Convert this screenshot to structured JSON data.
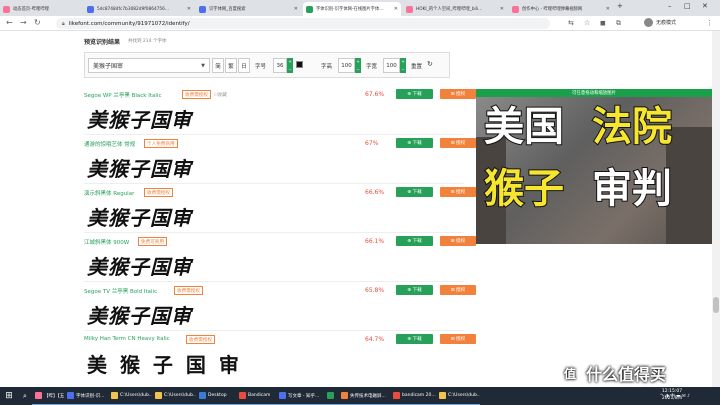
{
  "browser": {
    "tabs": [
      {
        "label": "动态首页-哔哩哔哩",
        "color": "#fb7299"
      },
      {
        "label": "5dc87484fc7b3082d9f0864756...",
        "color": "#4e6ef2"
      },
      {
        "label": "识字体网_百度搜索",
        "color": "#4e6ef2"
      },
      {
        "label": "字体识别-识字体网-在线图片字体...",
        "color": "#27a15a"
      },
      {
        "label": "HOKI_的个人空间_哔哩哔哩_bili...",
        "color": "#fb7299"
      },
      {
        "label": "创作中心 - 哔哩哔哩弹幕视频网",
        "color": "#fb7299"
      }
    ],
    "new_tab": "+",
    "minimize": "–",
    "maximize": "□",
    "close": "✕",
    "url": "likefont.com/community/91971072/identify/",
    "profile": "无痕模式"
  },
  "page": {
    "result_title": "预览识别结果",
    "result_count": "共找到 214 个字体",
    "controls": {
      "text_value": "美猴子国审",
      "simplified": "简",
      "traditional": "繁",
      "sun": "日",
      "size_label": "字号",
      "size_value": "36",
      "height_label": "字高",
      "height_value": "100",
      "width_label": "字宽",
      "width_value": "100",
      "reset": "重置"
    },
    "rows": [
      {
        "name": "Segoe WP 兰亭黑 Black Italic",
        "tag": "收费需授权",
        "fav": "☆收藏",
        "pct": "67.6%",
        "download": "下载",
        "authorize": "授权",
        "preview": "美猴子国审"
      },
      {
        "name": "通游的惊哦艺体 常规",
        "tag": "个人免费商用",
        "fav": "",
        "pct": "67%",
        "download": "下载",
        "authorize": "授权",
        "preview": "美猴子国审"
      },
      {
        "name": "演示斜黑体 Regular",
        "tag": "收费需授权",
        "fav": "",
        "pct": "66.6%",
        "download": "下载",
        "authorize": "授权",
        "preview": "美猴子国审"
      },
      {
        "name": "江城斜黑体 900W",
        "tag": "免费可商用",
        "fav": "",
        "pct": "66.1%",
        "download": "下载",
        "authorize": "授权",
        "preview": "美猴子国审"
      },
      {
        "name": "Segoe TV 兰亭黑 Bold Italic",
        "tag": "收费需授权",
        "fav": "",
        "pct": "65.8%",
        "download": "下载",
        "authorize": "授权",
        "preview": "美猴子国审"
      },
      {
        "name": "Milky Han Term CN Heavy Italic",
        "tag": "收费需授权",
        "fav": "",
        "pct": "64.7%",
        "download": "下载",
        "authorize": "授权",
        "preview": "美 猴 子 国 审"
      }
    ],
    "float_player": {
      "hint": "可任意拖动和缩放图片",
      "line1_white": "美国",
      "line1_yellow": "法院",
      "line2_yellow": "猴子",
      "line2_white": "审判"
    }
  },
  "taskbar": {
    "start": "⊞",
    "search": "⌕",
    "items": [
      {
        "label": "【哔】【五F...",
        "color": "#fb7299"
      },
      {
        "label": "字体识别-识...",
        "color": "#4e6ef2"
      },
      {
        "label": "C:\\Users\\dub...",
        "color": "#f2c14e"
      },
      {
        "label": "C:\\Users\\dub...",
        "color": "#f2c14e"
      },
      {
        "label": "Desktop",
        "color": "#3a7bd5"
      },
      {
        "label": "Bandicam",
        "color": "#e74c3c"
      },
      {
        "label": "写文章 - 知乎...",
        "color": "#4e6ef2"
      },
      {
        "label": "",
        "color": "#27a15a"
      },
      {
        "label": "失传技术电磁屏...",
        "color": "#f2813c"
      },
      {
        "label": "bandicam 20...",
        "color": "#e74c3c"
      },
      {
        "label": "C:\\Users\\dub...",
        "color": "#f2c14e"
      }
    ],
    "tray_text": "^ ◑ 中 ▬ ✉ ♪",
    "time": "12:15:07",
    "date": "2021/8/4"
  },
  "watermark": {
    "badge": "值",
    "text": "什么值得买"
  },
  "colors": {
    "accent_green": "#27a15a",
    "accent_orange": "#f2813c",
    "percent_red": "#e74c3c",
    "title_yellow": "#f7e62f"
  }
}
